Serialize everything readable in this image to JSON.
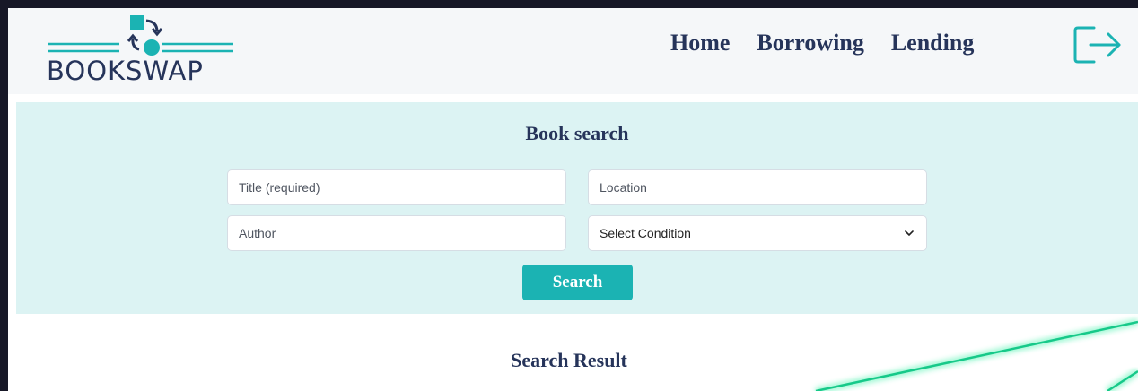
{
  "brand": {
    "name": "BOOKSWAP",
    "primary_color": "#26345a",
    "accent_color": "#1bb3b3",
    "panel_color": "#dcf3f3"
  },
  "nav": {
    "items": [
      {
        "label": "Home"
      },
      {
        "label": "Borrowing"
      },
      {
        "label": "Lending"
      }
    ],
    "logout_icon": "logout-icon"
  },
  "search": {
    "heading": "Book search",
    "title_placeholder": "Title (required)",
    "location_placeholder": "Location",
    "author_placeholder": "Author",
    "condition_selected": "Select Condition",
    "button_label": "Search"
  },
  "results": {
    "heading": "Search Result"
  }
}
